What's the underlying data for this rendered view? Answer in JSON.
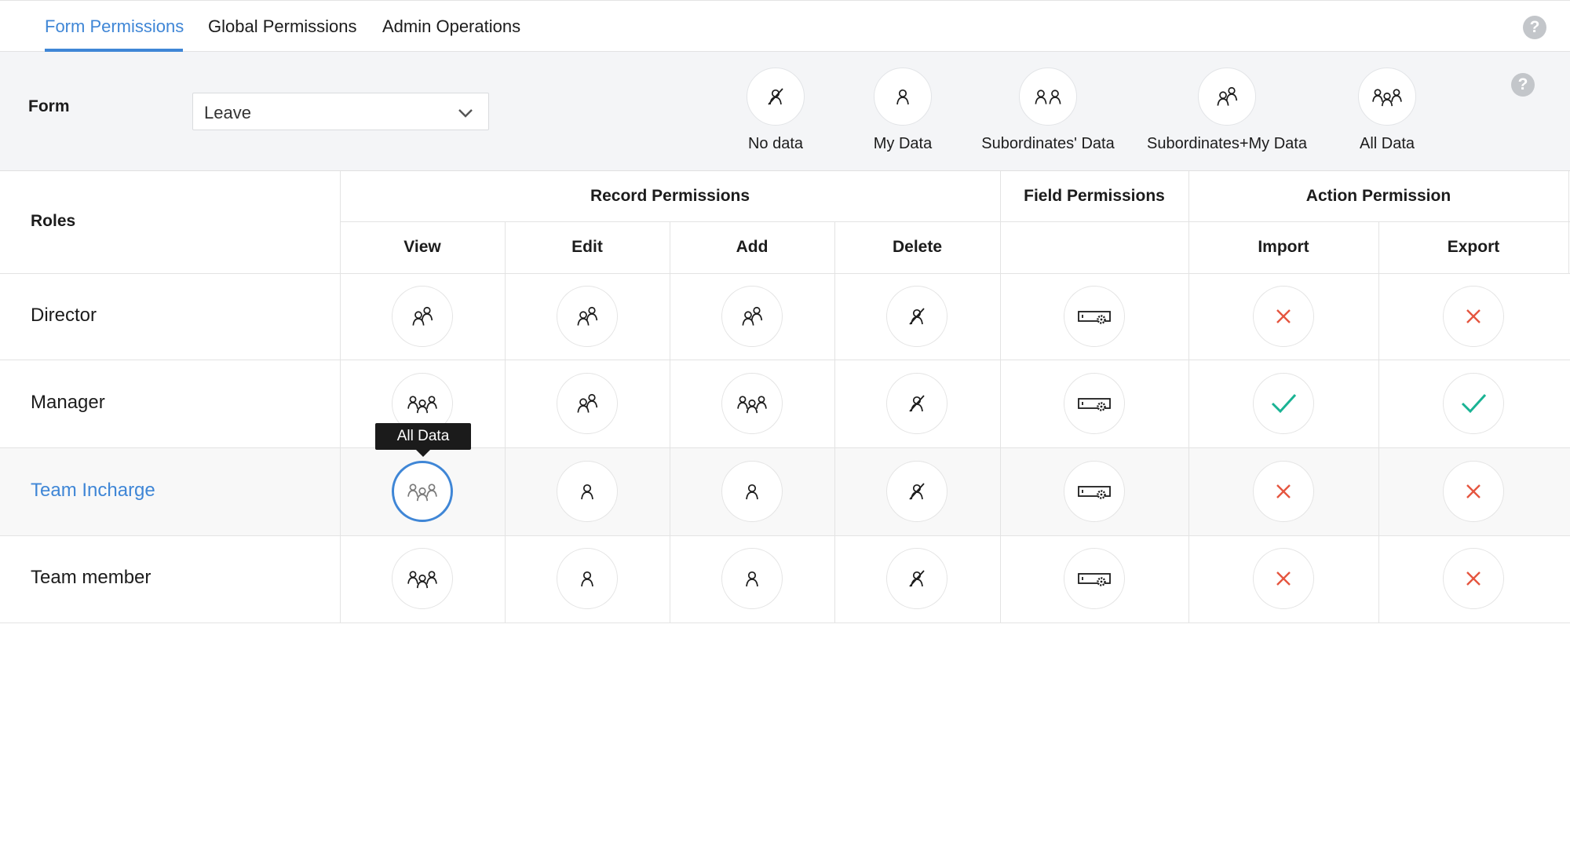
{
  "tabs": [
    {
      "label": "Form Permissions",
      "active": true
    },
    {
      "label": "Global Permissions",
      "active": false
    },
    {
      "label": "Admin Operations",
      "active": false
    }
  ],
  "help_icon_label": "?",
  "filter": {
    "form_label": "Form",
    "selected_form": "Leave",
    "legend": [
      {
        "label": "No data",
        "icon": "no-data-icon"
      },
      {
        "label": "My Data",
        "icon": "my-data-icon"
      },
      {
        "label": "Subordinates' Data",
        "icon": "subordinates-data-icon"
      },
      {
        "label": "Subordinates+My Data",
        "icon": "subordinates-my-data-icon"
      },
      {
        "label": "All Data",
        "icon": "all-data-icon"
      }
    ]
  },
  "table": {
    "roles_header": "Roles",
    "groups": {
      "record": "Record Permissions",
      "field": "Field Permissions",
      "action": "Action Permission"
    },
    "columns": [
      "View",
      "Edit",
      "Add",
      "Delete",
      "",
      "Import",
      "Export"
    ],
    "rows": [
      {
        "role": "Director",
        "active": false,
        "cells": [
          "subordinates-my-data",
          "subordinates-my-data",
          "subordinates-my-data",
          "no-data",
          "field-settings",
          "deny",
          "deny"
        ]
      },
      {
        "role": "Manager",
        "active": false,
        "cells": [
          "all-data",
          "subordinates-my-data",
          "all-data",
          "no-data",
          "field-settings",
          "allow",
          "allow"
        ]
      },
      {
        "role": "Team Incharge",
        "active": true,
        "cells": [
          "all-data",
          "my-data",
          "my-data",
          "no-data",
          "field-settings",
          "deny",
          "deny"
        ]
      },
      {
        "role": "Team member",
        "active": false,
        "cells": [
          "all-data",
          "my-data",
          "my-data",
          "no-data",
          "field-settings",
          "deny",
          "deny"
        ]
      }
    ]
  },
  "tooltip": {
    "text": "All Data"
  },
  "colors": {
    "accent": "#3f86d6",
    "allow": "#1ab394",
    "deny": "#e5553f"
  }
}
